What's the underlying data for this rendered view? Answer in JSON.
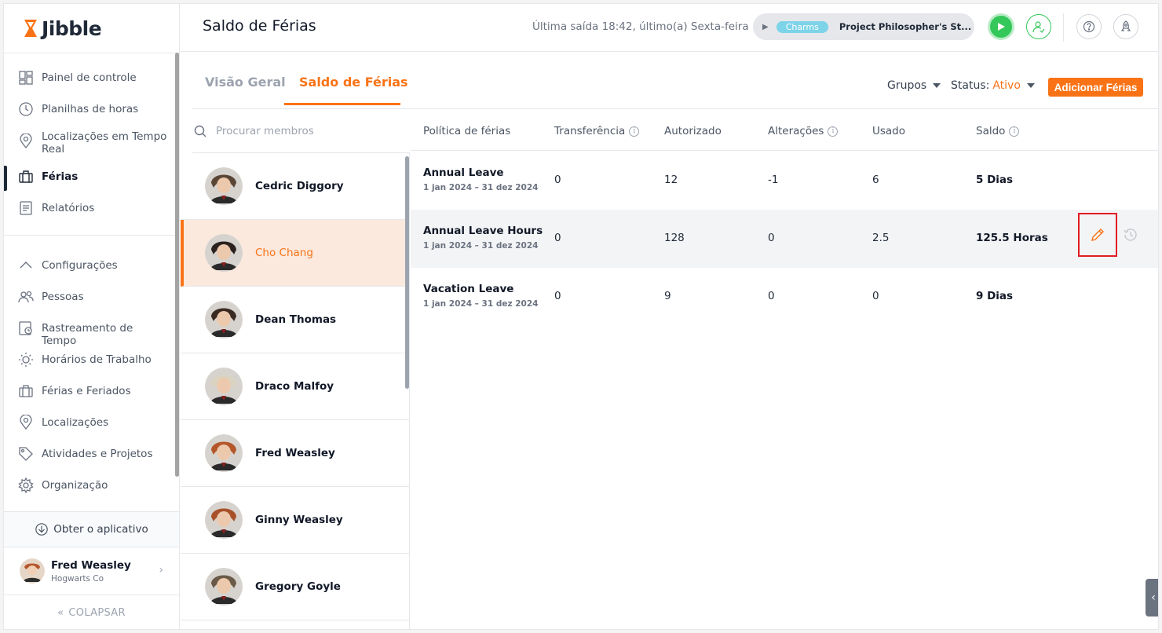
{
  "app": {
    "logo": "Jibble"
  },
  "sidebar": {
    "items": [
      {
        "id": "dashboard",
        "label": "Painel de controle",
        "icon": "dashboard-icon"
      },
      {
        "id": "timesheets",
        "label": "Planilhas de horas",
        "icon": "clock-icon"
      },
      {
        "id": "live-locations",
        "label": "Localizações em Tempo Real",
        "icon": "location-pin-icon"
      },
      {
        "id": "leave",
        "label": "Férias",
        "icon": "briefcase-icon",
        "active": true
      },
      {
        "id": "reports",
        "label": "Relatórios",
        "icon": "report-icon"
      }
    ],
    "settings": [
      {
        "id": "settings",
        "label": "Configurações",
        "icon": "chevron-up-icon"
      },
      {
        "id": "people",
        "label": "Pessoas",
        "icon": "people-icon"
      },
      {
        "id": "time-tracking",
        "label": "Rastreamento de Tempo",
        "icon": "time-tracking-icon"
      },
      {
        "id": "work-schedules",
        "label": "Horários de Trabalho",
        "icon": "sun-icon"
      },
      {
        "id": "leave-holidays",
        "label": "Férias e Feriados",
        "icon": "briefcase-icon"
      },
      {
        "id": "locations",
        "label": "Localizações",
        "icon": "location-pin-icon"
      },
      {
        "id": "activities",
        "label": "Atividades e Projetos",
        "icon": "tag-icon"
      },
      {
        "id": "organization",
        "label": "Organização",
        "icon": "gear-icon"
      }
    ],
    "get_app": "Obter o aplicativo",
    "profile": {
      "name": "Fred Weasley",
      "company": "Hogwarts Co"
    },
    "collapse": "COLAPSAR"
  },
  "header": {
    "title": "Saldo de Férias",
    "last_out": "Última saída 18:42, último(a) Sexta-feira",
    "timer": {
      "activity": "Charms",
      "project": "Project Philosopher's St..."
    }
  },
  "tabs": [
    {
      "label": "Visão Geral",
      "active": false
    },
    {
      "label": "Saldo de Férias",
      "active": true
    }
  ],
  "filters": {
    "groups": "Grupos",
    "status_label": "Status",
    "status_value": "Ativo",
    "add_button": "Adicionar Férias"
  },
  "search": {
    "placeholder": "Procurar membros"
  },
  "members": [
    {
      "name": "Cedric Diggory",
      "selected": false,
      "color": "#5b4636"
    },
    {
      "name": "Cho Chang",
      "selected": true,
      "color": "#2b2220"
    },
    {
      "name": "Dean Thomas",
      "selected": false,
      "color": "#3a2a22"
    },
    {
      "name": "Draco Malfoy",
      "selected": false,
      "color": "#d9d3c0"
    },
    {
      "name": "Fred Weasley",
      "selected": false,
      "color": "#b4562b"
    },
    {
      "name": "Ginny Weasley",
      "selected": false,
      "color": "#a8502a"
    },
    {
      "name": "Gregory Goyle",
      "selected": false,
      "color": "#6b5a48"
    }
  ],
  "table": {
    "columns": [
      "Política de férias",
      "Transferência",
      "Autorizado",
      "Alterações",
      "Usado",
      "Saldo"
    ],
    "rows": [
      {
        "policy": "Annual Leave",
        "period": "1 jan 2024 – 31 dez 2024",
        "transfer": "0",
        "authorized": "12",
        "changes": "-1",
        "used": "6",
        "balance": "5 Dias"
      },
      {
        "policy": "Annual Leave Hours",
        "period": "1 jan 2024 – 31 dez 2024",
        "transfer": "0",
        "authorized": "128",
        "changes": "0",
        "used": "2.5",
        "balance": "125.5 Horas"
      },
      {
        "policy": "Vacation Leave",
        "period": "1 jan 2024 – 31 dez 2024",
        "transfer": "0",
        "authorized": "9",
        "changes": "0",
        "used": "0",
        "balance": "9 Dias"
      }
    ]
  },
  "colors": {
    "accent": "#f97316",
    "play": "#34c759",
    "highlight": "#e11d24"
  }
}
